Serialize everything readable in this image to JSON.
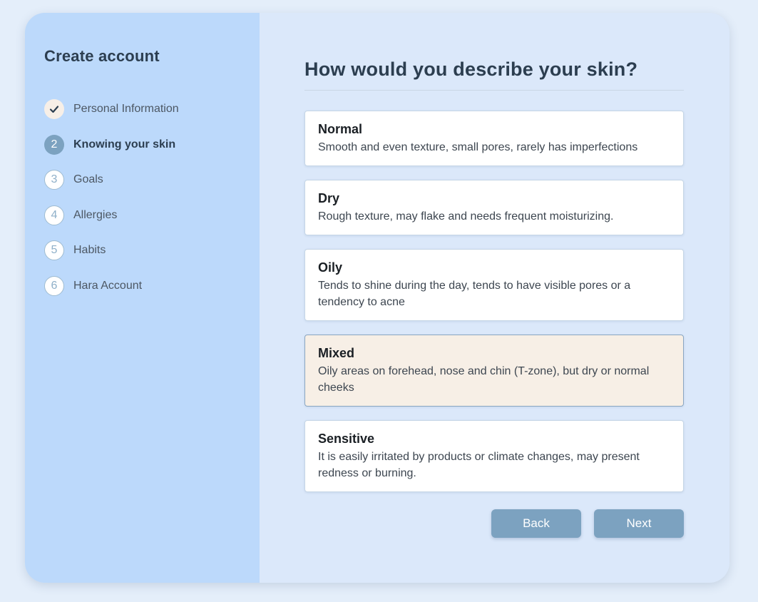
{
  "sidebar": {
    "title": "Create account",
    "steps": [
      {
        "number": "",
        "label": "Personal Information",
        "state": "done",
        "icon": "check-icon"
      },
      {
        "number": "2",
        "label": "Knowing your skin",
        "state": "active"
      },
      {
        "number": "3",
        "label": "Goals",
        "state": "pending"
      },
      {
        "number": "4",
        "label": "Allergies",
        "state": "pending"
      },
      {
        "number": "5",
        "label": "Habits",
        "state": "pending"
      },
      {
        "number": "6",
        "label": "Hara Account",
        "state": "pending"
      }
    ]
  },
  "main": {
    "question": "How would you describe your skin?",
    "options": [
      {
        "title": "Normal",
        "description": "Smooth and even texture, small pores, rarely has imperfections",
        "selected": false
      },
      {
        "title": "Dry",
        "description": "Rough texture, may flake and needs frequent moisturizing.",
        "selected": false
      },
      {
        "title": "Oily",
        "description": "Tends to shine during the day, tends to have visible pores or a tendency to acne",
        "selected": false
      },
      {
        "title": "Mixed",
        "description": "Oily areas on forehead, nose and chin (T-zone), but dry or normal cheeks",
        "selected": true
      },
      {
        "title": "Sensitive",
        "description": "It is easily irritated by products or climate changes, may present redness or burning.",
        "selected": false
      }
    ],
    "back_label": "Back",
    "next_label": "Next"
  },
  "colors": {
    "sidebar_bg": "#bcd9fb",
    "main_bg": "#dbe8fa",
    "accent": "#7ca2c0",
    "selected_bg": "#f7efe6"
  }
}
